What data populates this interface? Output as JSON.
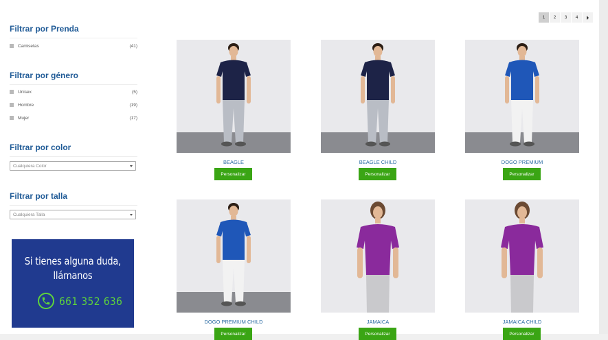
{
  "filters": {
    "prenda": {
      "title": "Filtrar por Prenda",
      "items": [
        {
          "label": "Camisetas",
          "count": "(41)"
        }
      ]
    },
    "genero": {
      "title": "Filtrar por género",
      "items": [
        {
          "label": "Unisex",
          "count": "(5)"
        },
        {
          "label": "Hombre",
          "count": "(19)"
        },
        {
          "label": "Mujer",
          "count": "(17)"
        }
      ]
    },
    "color": {
      "title": "Filtrar por color",
      "select_value": "Cualquiera Color"
    },
    "talla": {
      "title": "Filtrar por talla",
      "select_value": "Cualquiera Talla"
    }
  },
  "banner": {
    "line1": "Si tienes alguna duda,",
    "line2": "llámanos",
    "phone": "661 352 636",
    "bg_color": "#203a8f",
    "accent_color": "#5ed43b"
  },
  "pagination": {
    "pages": [
      "1",
      "2",
      "3",
      "4"
    ],
    "active": "1",
    "next_icon": "arrow-right-icon"
  },
  "products": [
    {
      "name": "BEAGLE",
      "button": "Personalizar",
      "shirt_color": "#1d2347",
      "pants_color": "#b9bdc5",
      "figure": "man"
    },
    {
      "name": "BEAGLE CHILD",
      "button": "Personalizar",
      "shirt_color": "#1d2347",
      "pants_color": "#b9bdc5",
      "figure": "man"
    },
    {
      "name": "DOGO PREMIUM",
      "button": "Personalizar",
      "shirt_color": "#1f57b8",
      "pants_color": "#f2f2f2",
      "figure": "man"
    },
    {
      "name": "DOGO PREMIUM CHILD",
      "button": "Personalizar",
      "shirt_color": "#1f57b8",
      "pants_color": "#f2f2f2",
      "figure": "man"
    },
    {
      "name": "JAMAICA",
      "button": "Personalizar",
      "shirt_color": "#8a2a9c",
      "pants_color": "#c9c9cc",
      "figure": "woman"
    },
    {
      "name": "JAMAICA CHILD",
      "button": "Personalizar",
      "shirt_color": "#8a2a9c",
      "pants_color": "#c9c9cc",
      "figure": "woman"
    }
  ]
}
